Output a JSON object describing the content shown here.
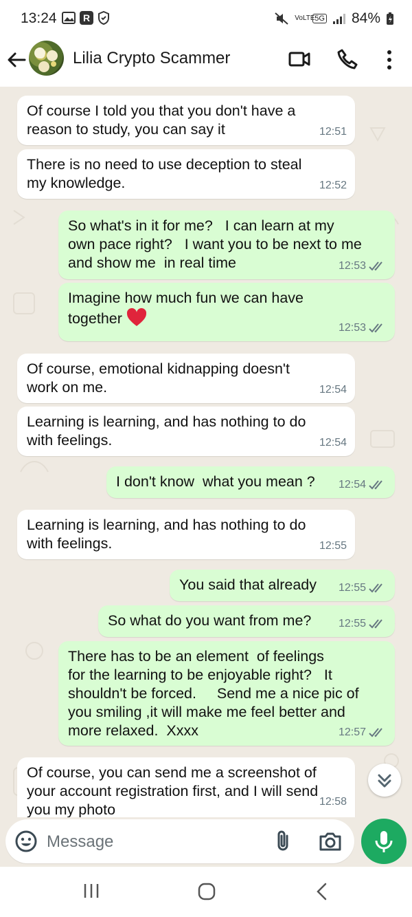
{
  "status_bar": {
    "time": "13:24",
    "network": "5G",
    "volte": "VoLTE",
    "battery": "84%"
  },
  "header": {
    "contact_name": "Lilia Crypto Scammer"
  },
  "messages": [
    {
      "dir": "in",
      "text": "Of course I told you that you don't have a\nreason to study, you can say it",
      "time": "12:51"
    },
    {
      "dir": "in",
      "text": "There is no need to use deception to steal\nmy knowledge.",
      "time": "12:52"
    },
    {
      "dir": "out",
      "text": "So what's in it for me?   I can learn at my\nown pace right?   I want you to be next to me\nand show me  in real time",
      "time": "12:53"
    },
    {
      "dir": "out",
      "text": "Imagine how much fun we can have\ntogether",
      "time": "12:53"
    },
    {
      "dir": "in",
      "text": "Of course, emotional kidnapping doesn't\nwork on me.",
      "time": "12:54"
    },
    {
      "dir": "in",
      "text": "Learning is learning, and has nothing to do\nwith feelings.",
      "time": "12:54"
    },
    {
      "dir": "out",
      "text": "I don't know  what you mean ?",
      "time": "12:54"
    },
    {
      "dir": "in",
      "text": "Learning is learning, and has nothing to do\nwith feelings.",
      "time": "12:55"
    },
    {
      "dir": "out",
      "text": "You said that already",
      "time": "12:55"
    },
    {
      "dir": "out",
      "text": "So what do you want from me?",
      "time": "12:55"
    },
    {
      "dir": "out",
      "text": "There has to be an element  of feelings\nfor the learning to be enjoyable right?   It\nshouldn't be forced.     Send me a nice pic of\nyou smiling ,it will make me feel better and\nmore relaxed.  Xxxx",
      "time": "12:57"
    },
    {
      "dir": "in",
      "text": "Of course, you can send me a screenshot of\nyour account registration first, and I will send\nyou my photo",
      "time": "12:58"
    }
  ],
  "composer": {
    "placeholder": "Message"
  },
  "colors": {
    "accent": "#1daa61",
    "outgoing_bubble": "#d9fdd3",
    "incoming_bubble": "#ffffff",
    "chat_background": "#efeae2",
    "read_ticks": "#53bdeb"
  },
  "icons": {
    "back": "arrow-left-icon",
    "video": "video-camera-icon",
    "call": "phone-icon",
    "menu": "more-vertical-icon",
    "emoji": "emoji-icon",
    "attach": "paperclip-icon",
    "camera": "camera-icon",
    "mic": "microphone-icon",
    "scroll_down": "chevron-double-down-icon"
  }
}
